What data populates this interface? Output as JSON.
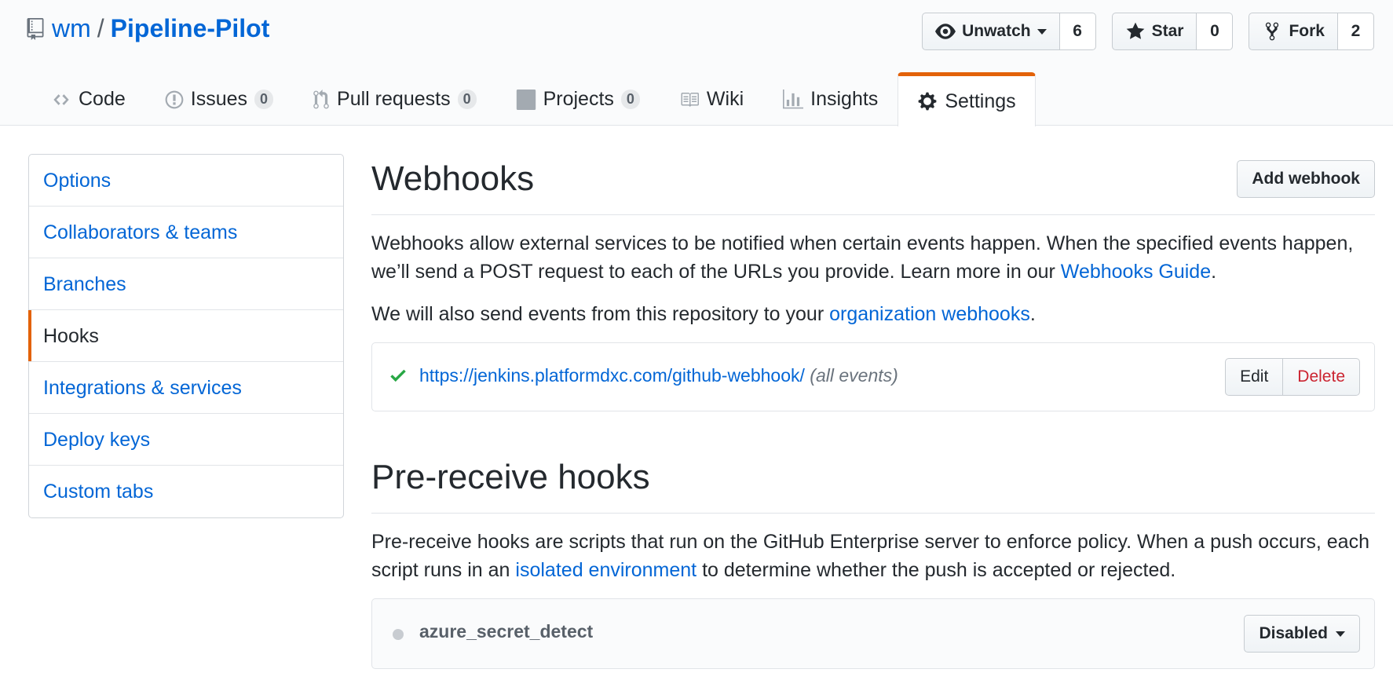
{
  "repo": {
    "owner": "wm",
    "separator": "/",
    "name": "Pipeline-Pilot"
  },
  "actions": {
    "watch": {
      "label": "Unwatch",
      "count": "6"
    },
    "star": {
      "label": "Star",
      "count": "0"
    },
    "fork": {
      "label": "Fork",
      "count": "2"
    }
  },
  "nav": {
    "code": {
      "label": "Code"
    },
    "issues": {
      "label": "Issues",
      "count": "0"
    },
    "pulls": {
      "label": "Pull requests",
      "count": "0"
    },
    "projects": {
      "label": "Projects",
      "count": "0"
    },
    "wiki": {
      "label": "Wiki"
    },
    "insights": {
      "label": "Insights"
    },
    "settings": {
      "label": "Settings"
    }
  },
  "sidebar": {
    "items": [
      {
        "label": "Options"
      },
      {
        "label": "Collaborators & teams"
      },
      {
        "label": "Branches"
      },
      {
        "label": "Hooks"
      },
      {
        "label": "Integrations & services"
      },
      {
        "label": "Deploy keys"
      },
      {
        "label": "Custom tabs"
      }
    ],
    "selected": "Hooks"
  },
  "webhooks": {
    "title": "Webhooks",
    "add_button": "Add webhook",
    "desc_1": "Webhooks allow external services to be notified when certain events happen. When the specified events happen, we’ll send a POST request to each of the URLs you provide. Learn more in our ",
    "guide_link": "Webhooks Guide",
    "desc_1_end": ".",
    "desc_2": "We will also send events from this repository to your ",
    "org_link": "organization webhooks",
    "desc_2_end": ".",
    "hook": {
      "url": "https://jenkins.platformdxc.com/github-webhook/",
      "events": "(all events)",
      "edit": "Edit",
      "delete": "Delete"
    }
  },
  "prereceive": {
    "title": "Pre-receive hooks",
    "desc_1": "Pre-receive hooks are scripts that run on the GitHub Enterprise server to enforce policy. When a push occurs, each script runs in an ",
    "isolated_link": "isolated environment",
    "desc_1_end": " to determine whether the push is accepted or rejected.",
    "hook": {
      "name": "azure_secret_detect",
      "state": "Disabled"
    }
  },
  "colors": {
    "link": "#0366d6",
    "accent": "#e36209",
    "success": "#28a745",
    "danger": "#cb2431"
  }
}
